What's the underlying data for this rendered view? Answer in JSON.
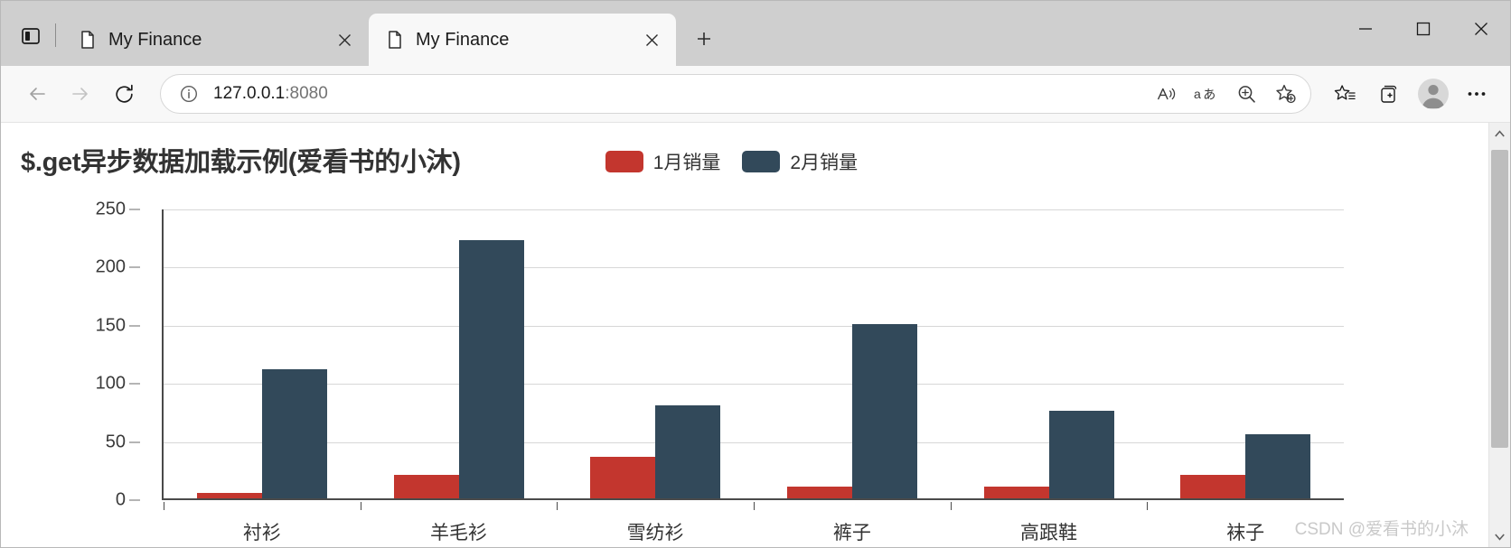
{
  "window": {
    "controls": {
      "minimize": "minimize-icon",
      "maximize": "maximize-icon",
      "close": "close-icon"
    },
    "tab_search_icon": "tab-search-icon",
    "new_tab_label": "+"
  },
  "tabs": [
    {
      "title": "My Finance",
      "active": false,
      "favicon": "page-icon",
      "close": "×"
    },
    {
      "title": "My Finance",
      "active": true,
      "favicon": "page-icon",
      "close": "×"
    }
  ],
  "toolbar": {
    "back_icon": "back-arrow-icon",
    "forward_icon": "forward-arrow-icon",
    "refresh_icon": "refresh-icon",
    "site_info_icon": "info-icon",
    "url_text": "127.0.0.1",
    "url_port": ":8080",
    "read_aloud_icon": "read-aloud-icon",
    "translate_icon": "translate-icon",
    "zoom_icon": "zoom-search-icon",
    "add_favorite_icon": "add-favorite-star-icon",
    "favorites_icon": "favorites-icon",
    "collections_icon": "collections-icon",
    "profile_icon": "profile-avatar-icon",
    "settings_icon": "more-settings-icon"
  },
  "page": {
    "watermark": "CSDN @爱看书的小沐"
  },
  "chart_data": {
    "type": "bar",
    "title": "$.get异步数据加载示例(爱看书的小沐)",
    "categories": [
      "衬衫",
      "羊毛衫",
      "雪纺衫",
      "裤子",
      "高跟鞋",
      "袜子"
    ],
    "series": [
      {
        "name": "1月销量",
        "color": "#c3362e",
        "values": [
          5,
          20,
          36,
          10,
          10,
          20
        ]
      },
      {
        "name": "2月销量",
        "color": "#32495a",
        "values": [
          111,
          222,
          80,
          150,
          75,
          55
        ]
      }
    ],
    "yticks": [
      0,
      50,
      100,
      150,
      200,
      250
    ],
    "ylim": [
      0,
      250
    ],
    "xlabel": "",
    "ylabel": "",
    "grid": true,
    "legend_position": "top"
  }
}
